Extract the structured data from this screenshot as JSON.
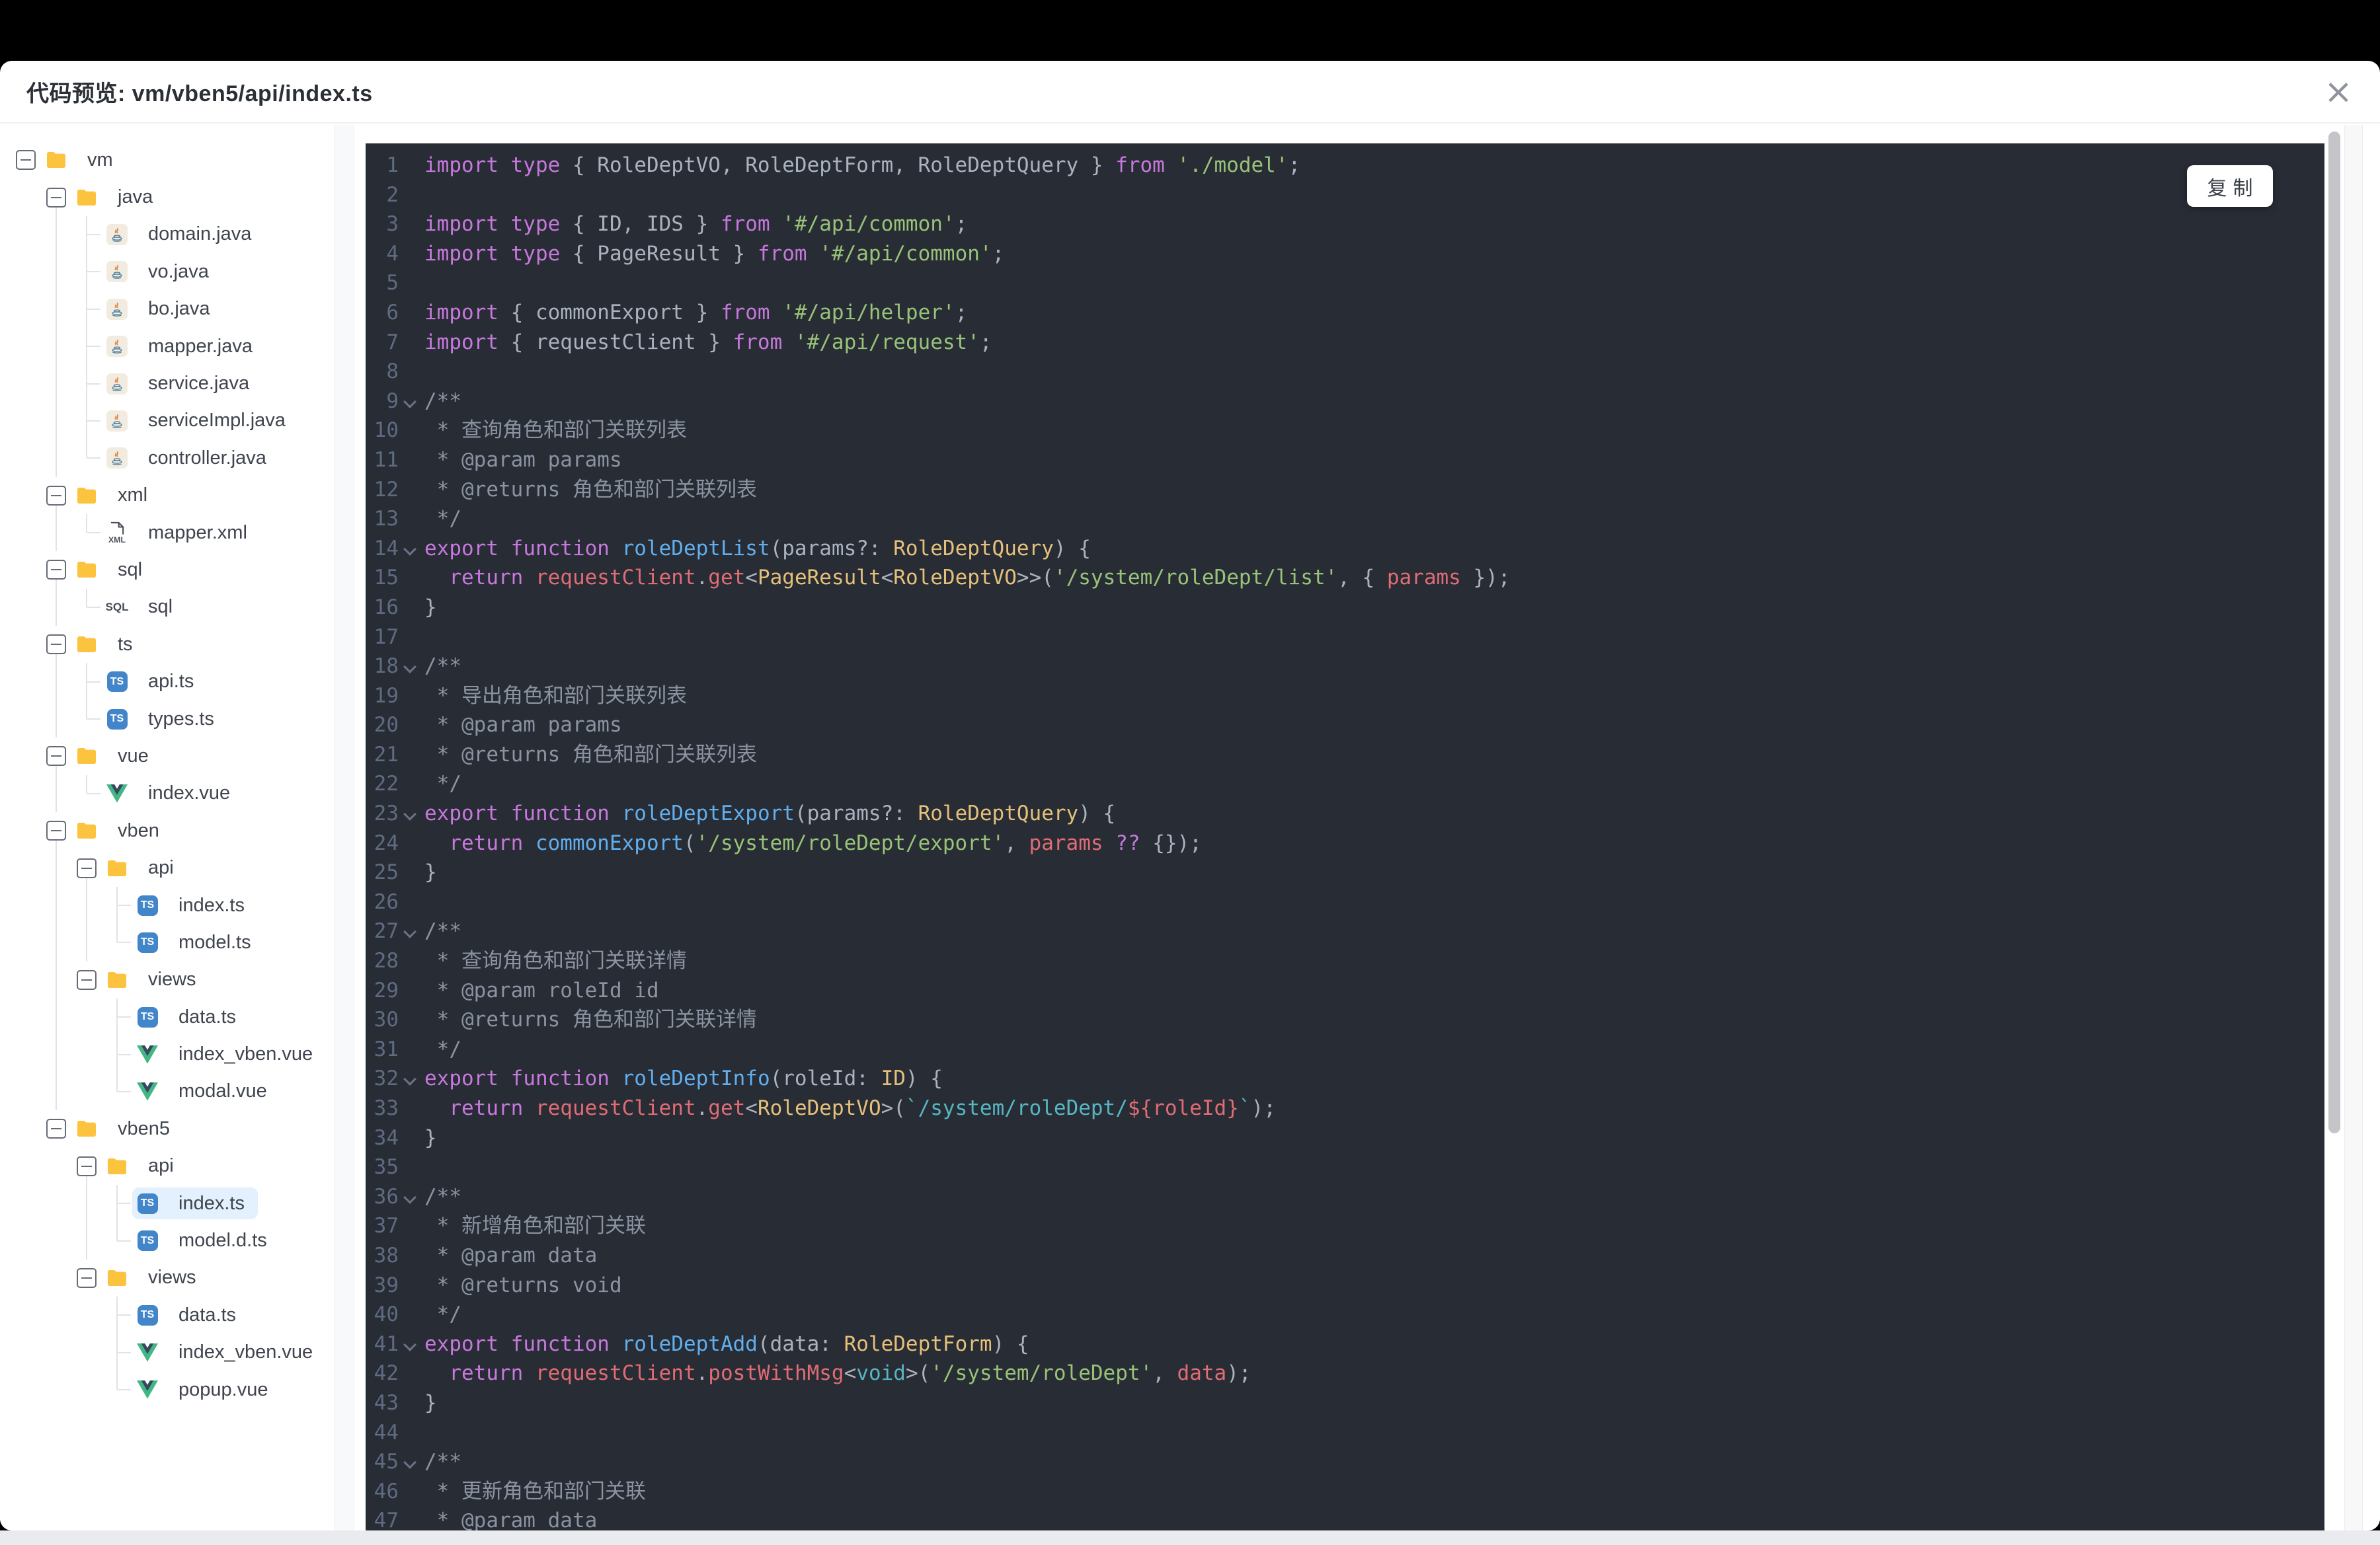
{
  "window": {
    "title": "代码预览: vm/vben5/api/index.ts",
    "close_icon": "×"
  },
  "code_panel": {
    "copy_button": "复制"
  },
  "icons": {
    "ts_badge": "TS",
    "sql_label": "SQL",
    "xml_label": "XML"
  },
  "colors": {
    "code_bg": "#282c34",
    "selected_row_bg": "#e2f1fd",
    "folder": "#fcc43e",
    "ts_badge_bg": "#4285c9",
    "vue_green": "#41b883",
    "vue_dark": "#34495e",
    "java_orange": "#e07a2e",
    "java_blue": "#5382a1",
    "scroll_thumb": "#c3c5c8",
    "syntax": {
      "k": "#c678dd",
      "s": "#98c379",
      "t": "#e5c07b",
      "f": "#61afef",
      "v": "#e06c75",
      "y": "#56b6c2",
      "c": "#8b93a2",
      "d": "#abb2bf",
      "ln": "#5f6b81"
    }
  },
  "tree": [
    {
      "label": "vm",
      "icon": "folder",
      "cols": [
        "toggle"
      ],
      "selected": false
    },
    {
      "label": "java",
      "icon": "folder",
      "cols": [
        "empty",
        "toggleline"
      ],
      "selected": false
    },
    {
      "label": "domain.java",
      "icon": "java",
      "cols": [
        "empty",
        "guide",
        "conn"
      ],
      "selected": false
    },
    {
      "label": "vo.java",
      "icon": "java",
      "cols": [
        "empty",
        "guide",
        "conn"
      ],
      "selected": false
    },
    {
      "label": "bo.java",
      "icon": "java",
      "cols": [
        "empty",
        "guide",
        "conn"
      ],
      "selected": false
    },
    {
      "label": "mapper.java",
      "icon": "java",
      "cols": [
        "empty",
        "guide",
        "conn"
      ],
      "selected": false
    },
    {
      "label": "service.java",
      "icon": "java",
      "cols": [
        "empty",
        "guide",
        "conn"
      ],
      "selected": false
    },
    {
      "label": "serviceImpl.java",
      "icon": "java",
      "cols": [
        "empty",
        "guide",
        "conn"
      ],
      "selected": false
    },
    {
      "label": "controller.java",
      "icon": "java",
      "cols": [
        "empty",
        "guide",
        "connend"
      ],
      "selected": false
    },
    {
      "label": "xml",
      "icon": "folder",
      "cols": [
        "empty",
        "toggleline"
      ],
      "selected": false
    },
    {
      "label": "mapper.xml",
      "icon": "xml",
      "cols": [
        "empty",
        "guide",
        "connend"
      ],
      "selected": false
    },
    {
      "label": "sql",
      "icon": "folder",
      "cols": [
        "empty",
        "toggleline"
      ],
      "selected": false
    },
    {
      "label": "sql",
      "icon": "sql",
      "cols": [
        "empty",
        "guide",
        "connend"
      ],
      "selected": false
    },
    {
      "label": "ts",
      "icon": "folder",
      "cols": [
        "empty",
        "toggleline"
      ],
      "selected": false
    },
    {
      "label": "api.ts",
      "icon": "ts",
      "cols": [
        "empty",
        "guide",
        "conn"
      ],
      "selected": false
    },
    {
      "label": "types.ts",
      "icon": "ts",
      "cols": [
        "empty",
        "guide",
        "connend"
      ],
      "selected": false
    },
    {
      "label": "vue",
      "icon": "folder",
      "cols": [
        "empty",
        "toggleline"
      ],
      "selected": false
    },
    {
      "label": "index.vue",
      "icon": "vue",
      "cols": [
        "empty",
        "guide",
        "connend"
      ],
      "selected": false
    },
    {
      "label": "vben",
      "icon": "folder",
      "cols": [
        "empty",
        "toggleline"
      ],
      "selected": false
    },
    {
      "label": "api",
      "icon": "folder",
      "cols": [
        "empty",
        "guide",
        "toggleline"
      ],
      "selected": false
    },
    {
      "label": "index.ts",
      "icon": "ts",
      "cols": [
        "empty",
        "guide",
        "guide",
        "conn"
      ],
      "selected": false
    },
    {
      "label": "model.ts",
      "icon": "ts",
      "cols": [
        "empty",
        "guide",
        "guide",
        "connend"
      ],
      "selected": false
    },
    {
      "label": "views",
      "icon": "folder",
      "cols": [
        "empty",
        "guide",
        "toggle"
      ],
      "selected": false
    },
    {
      "label": "data.ts",
      "icon": "ts",
      "cols": [
        "empty",
        "guide",
        "empty",
        "conn"
      ],
      "selected": false
    },
    {
      "label": "index_vben.vue",
      "icon": "vue",
      "cols": [
        "empty",
        "guide",
        "empty",
        "conn"
      ],
      "selected": false
    },
    {
      "label": "modal.vue",
      "icon": "vue",
      "cols": [
        "empty",
        "guide",
        "empty",
        "connend"
      ],
      "selected": false
    },
    {
      "label": "vben5",
      "icon": "folder",
      "cols": [
        "empty",
        "toggle"
      ],
      "selected": false
    },
    {
      "label": "api",
      "icon": "folder",
      "cols": [
        "empty",
        "empty",
        "toggleline"
      ],
      "selected": false
    },
    {
      "label": "index.ts",
      "icon": "ts",
      "cols": [
        "empty",
        "empty",
        "guide",
        "conn"
      ],
      "selected": true
    },
    {
      "label": "model.d.ts",
      "icon": "ts",
      "cols": [
        "empty",
        "empty",
        "guide",
        "connend"
      ],
      "selected": false
    },
    {
      "label": "views",
      "icon": "folder",
      "cols": [
        "empty",
        "empty",
        "toggle"
      ],
      "selected": false
    },
    {
      "label": "data.ts",
      "icon": "ts",
      "cols": [
        "empty",
        "empty",
        "empty",
        "conn"
      ],
      "selected": false
    },
    {
      "label": "index_vben.vue",
      "icon": "vue",
      "cols": [
        "empty",
        "empty",
        "empty",
        "conn"
      ],
      "selected": false
    },
    {
      "label": "popup.vue",
      "icon": "vue",
      "cols": [
        "empty",
        "empty",
        "empty",
        "connend"
      ],
      "selected": false
    }
  ],
  "code_lines": [
    {
      "n": 1,
      "fold": false,
      "seg": [
        [
          "k",
          "import type"
        ],
        [
          "d",
          " { RoleDeptVO, RoleDeptForm, RoleDeptQuery } "
        ],
        [
          "k",
          "from"
        ],
        [
          "d",
          " "
        ],
        [
          "s",
          "'./model'"
        ],
        [
          "d",
          ";"
        ]
      ]
    },
    {
      "n": 2,
      "fold": false,
      "seg": []
    },
    {
      "n": 3,
      "fold": false,
      "seg": [
        [
          "k",
          "import type"
        ],
        [
          "d",
          " { ID, IDS } "
        ],
        [
          "k",
          "from"
        ],
        [
          "d",
          " "
        ],
        [
          "s",
          "'#/api/common'"
        ],
        [
          "d",
          ";"
        ]
      ]
    },
    {
      "n": 4,
      "fold": false,
      "seg": [
        [
          "k",
          "import type"
        ],
        [
          "d",
          " { PageResult } "
        ],
        [
          "k",
          "from"
        ],
        [
          "d",
          " "
        ],
        [
          "s",
          "'#/api/common'"
        ],
        [
          "d",
          ";"
        ]
      ]
    },
    {
      "n": 5,
      "fold": false,
      "seg": []
    },
    {
      "n": 6,
      "fold": false,
      "seg": [
        [
          "k",
          "import"
        ],
        [
          "d",
          " { commonExport } "
        ],
        [
          "k",
          "from"
        ],
        [
          "d",
          " "
        ],
        [
          "s",
          "'#/api/helper'"
        ],
        [
          "d",
          ";"
        ]
      ]
    },
    {
      "n": 7,
      "fold": false,
      "seg": [
        [
          "k",
          "import"
        ],
        [
          "d",
          " { requestClient } "
        ],
        [
          "k",
          "from"
        ],
        [
          "d",
          " "
        ],
        [
          "s",
          "'#/api/request'"
        ],
        [
          "d",
          ";"
        ]
      ]
    },
    {
      "n": 8,
      "fold": false,
      "seg": []
    },
    {
      "n": 9,
      "fold": true,
      "seg": [
        [
          "c",
          "/**"
        ]
      ]
    },
    {
      "n": 10,
      "fold": false,
      "seg": [
        [
          "c",
          " * 查询角色和部门关联列表"
        ]
      ]
    },
    {
      "n": 11,
      "fold": false,
      "seg": [
        [
          "c",
          " * @param params"
        ]
      ]
    },
    {
      "n": 12,
      "fold": false,
      "seg": [
        [
          "c",
          " * @returns 角色和部门关联列表"
        ]
      ]
    },
    {
      "n": 13,
      "fold": false,
      "seg": [
        [
          "c",
          " */"
        ]
      ]
    },
    {
      "n": 14,
      "fold": true,
      "seg": [
        [
          "k",
          "export"
        ],
        [
          "d",
          " "
        ],
        [
          "k",
          "function"
        ],
        [
          "d",
          " "
        ],
        [
          "f",
          "roleDeptList"
        ],
        [
          "d",
          "(params?: "
        ],
        [
          "t",
          "RoleDeptQuery"
        ],
        [
          "d",
          ") {"
        ]
      ]
    },
    {
      "n": 15,
      "fold": false,
      "seg": [
        [
          "d",
          "  "
        ],
        [
          "k",
          "return"
        ],
        [
          "d",
          " "
        ],
        [
          "v",
          "requestClient"
        ],
        [
          "d",
          "."
        ],
        [
          "v",
          "get"
        ],
        [
          "d",
          "<"
        ],
        [
          "t",
          "PageResult"
        ],
        [
          "d",
          "<"
        ],
        [
          "t",
          "RoleDeptVO"
        ],
        [
          "d",
          ">>("
        ],
        [
          "s",
          "'/system/roleDept/list'"
        ],
        [
          "d",
          ", { "
        ],
        [
          "v",
          "params"
        ],
        [
          "d",
          " });"
        ]
      ]
    },
    {
      "n": 16,
      "fold": false,
      "seg": [
        [
          "d",
          "}"
        ]
      ]
    },
    {
      "n": 17,
      "fold": false,
      "seg": []
    },
    {
      "n": 18,
      "fold": true,
      "seg": [
        [
          "c",
          "/**"
        ]
      ]
    },
    {
      "n": 19,
      "fold": false,
      "seg": [
        [
          "c",
          " * 导出角色和部门关联列表"
        ]
      ]
    },
    {
      "n": 20,
      "fold": false,
      "seg": [
        [
          "c",
          " * @param params"
        ]
      ]
    },
    {
      "n": 21,
      "fold": false,
      "seg": [
        [
          "c",
          " * @returns 角色和部门关联列表"
        ]
      ]
    },
    {
      "n": 22,
      "fold": false,
      "seg": [
        [
          "c",
          " */"
        ]
      ]
    },
    {
      "n": 23,
      "fold": true,
      "seg": [
        [
          "k",
          "export"
        ],
        [
          "d",
          " "
        ],
        [
          "k",
          "function"
        ],
        [
          "d",
          " "
        ],
        [
          "f",
          "roleDeptExport"
        ],
        [
          "d",
          "(params?: "
        ],
        [
          "t",
          "RoleDeptQuery"
        ],
        [
          "d",
          ") {"
        ]
      ]
    },
    {
      "n": 24,
      "fold": false,
      "seg": [
        [
          "d",
          "  "
        ],
        [
          "k",
          "return"
        ],
        [
          "d",
          " "
        ],
        [
          "f",
          "commonExport"
        ],
        [
          "d",
          "("
        ],
        [
          "s",
          "'/system/roleDept/export'"
        ],
        [
          "d",
          ", "
        ],
        [
          "v",
          "params"
        ],
        [
          "d",
          " "
        ],
        [
          "k",
          "??"
        ],
        [
          "d",
          " {});"
        ]
      ]
    },
    {
      "n": 25,
      "fold": false,
      "seg": [
        [
          "d",
          "}"
        ]
      ]
    },
    {
      "n": 26,
      "fold": false,
      "seg": []
    },
    {
      "n": 27,
      "fold": true,
      "seg": [
        [
          "c",
          "/**"
        ]
      ]
    },
    {
      "n": 28,
      "fold": false,
      "seg": [
        [
          "c",
          " * 查询角色和部门关联详情"
        ]
      ]
    },
    {
      "n": 29,
      "fold": false,
      "seg": [
        [
          "c",
          " * @param roleId id"
        ]
      ]
    },
    {
      "n": 30,
      "fold": false,
      "seg": [
        [
          "c",
          " * @returns 角色和部门关联详情"
        ]
      ]
    },
    {
      "n": 31,
      "fold": false,
      "seg": [
        [
          "c",
          " */"
        ]
      ]
    },
    {
      "n": 32,
      "fold": true,
      "seg": [
        [
          "k",
          "export"
        ],
        [
          "d",
          " "
        ],
        [
          "k",
          "function"
        ],
        [
          "d",
          " "
        ],
        [
          "f",
          "roleDeptInfo"
        ],
        [
          "d",
          "(roleId: "
        ],
        [
          "t",
          "ID"
        ],
        [
          "d",
          ") {"
        ]
      ]
    },
    {
      "n": 33,
      "fold": false,
      "seg": [
        [
          "d",
          "  "
        ],
        [
          "k",
          "return"
        ],
        [
          "d",
          " "
        ],
        [
          "v",
          "requestClient"
        ],
        [
          "d",
          "."
        ],
        [
          "v",
          "get"
        ],
        [
          "d",
          "<"
        ],
        [
          "t",
          "RoleDeptVO"
        ],
        [
          "d",
          ">("
        ],
        [
          "y",
          "`/system/roleDept/"
        ],
        [
          "v",
          "${roleId}"
        ],
        [
          "y",
          "`"
        ],
        [
          "d",
          ");"
        ]
      ]
    },
    {
      "n": 34,
      "fold": false,
      "seg": [
        [
          "d",
          "}"
        ]
      ]
    },
    {
      "n": 35,
      "fold": false,
      "seg": []
    },
    {
      "n": 36,
      "fold": true,
      "seg": [
        [
          "c",
          "/**"
        ]
      ]
    },
    {
      "n": 37,
      "fold": false,
      "seg": [
        [
          "c",
          " * 新增角色和部门关联"
        ]
      ]
    },
    {
      "n": 38,
      "fold": false,
      "seg": [
        [
          "c",
          " * @param data"
        ]
      ]
    },
    {
      "n": 39,
      "fold": false,
      "seg": [
        [
          "c",
          " * @returns void"
        ]
      ]
    },
    {
      "n": 40,
      "fold": false,
      "seg": [
        [
          "c",
          " */"
        ]
      ]
    },
    {
      "n": 41,
      "fold": true,
      "seg": [
        [
          "k",
          "export"
        ],
        [
          "d",
          " "
        ],
        [
          "k",
          "function"
        ],
        [
          "d",
          " "
        ],
        [
          "f",
          "roleDeptAdd"
        ],
        [
          "d",
          "(data: "
        ],
        [
          "t",
          "RoleDeptForm"
        ],
        [
          "d",
          ") {"
        ]
      ]
    },
    {
      "n": 42,
      "fold": false,
      "seg": [
        [
          "d",
          "  "
        ],
        [
          "k",
          "return"
        ],
        [
          "d",
          " "
        ],
        [
          "v",
          "requestClient"
        ],
        [
          "d",
          "."
        ],
        [
          "v",
          "postWithMsg"
        ],
        [
          "d",
          "<"
        ],
        [
          "y",
          "void"
        ],
        [
          "d",
          ">("
        ],
        [
          "s",
          "'/system/roleDept'"
        ],
        [
          "d",
          ", "
        ],
        [
          "v",
          "data"
        ],
        [
          "d",
          ");"
        ]
      ]
    },
    {
      "n": 43,
      "fold": false,
      "seg": [
        [
          "d",
          "}"
        ]
      ]
    },
    {
      "n": 44,
      "fold": false,
      "seg": []
    },
    {
      "n": 45,
      "fold": true,
      "seg": [
        [
          "c",
          "/**"
        ]
      ]
    },
    {
      "n": 46,
      "fold": false,
      "seg": [
        [
          "c",
          " * 更新角色和部门关联"
        ]
      ]
    },
    {
      "n": 47,
      "fold": false,
      "seg": [
        [
          "c",
          " * @param data"
        ]
      ]
    }
  ]
}
